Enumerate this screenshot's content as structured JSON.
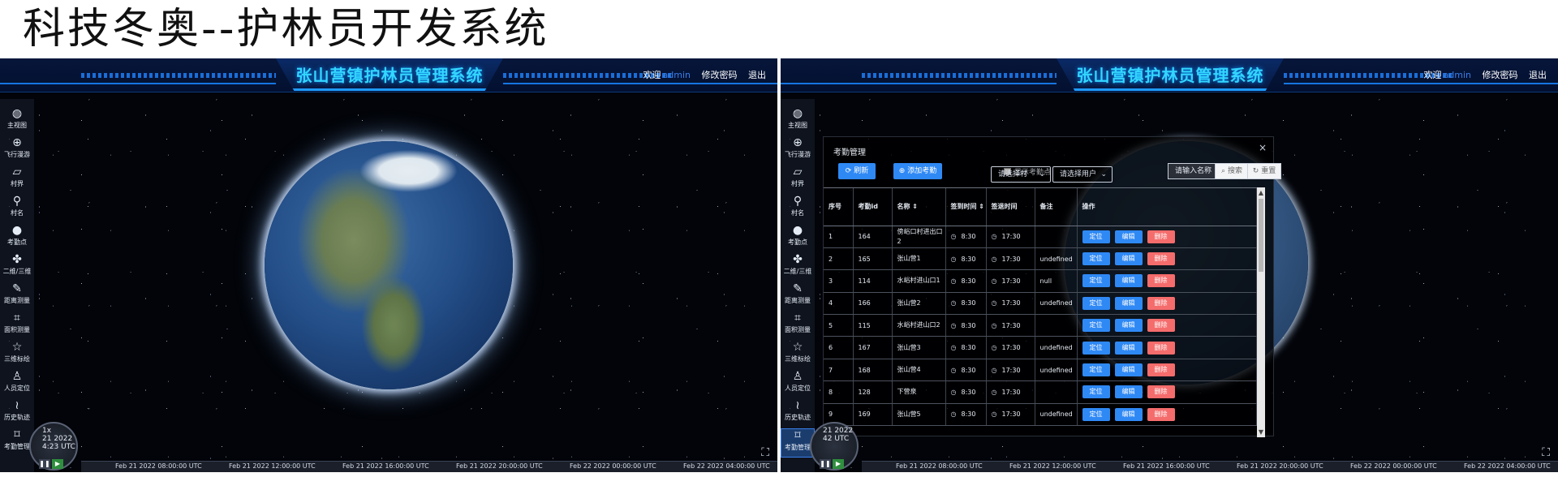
{
  "page_title": "科技冬奥--护林员开发系统",
  "header": {
    "title": "张山营镇护林员管理系统",
    "welcome": "欢迎",
    "username": "admin",
    "change_password": "修改密码",
    "logout": "退出"
  },
  "sidebar": {
    "items": [
      {
        "label": "主视图",
        "icon": "globe-icon"
      },
      {
        "label": "飞行漫游",
        "icon": "world-icon"
      },
      {
        "label": "村界",
        "icon": "boundary-icon"
      },
      {
        "label": "村名",
        "icon": "pin-icon"
      },
      {
        "label": "考勤点",
        "icon": "marker-icon"
      },
      {
        "label": "二维/三维",
        "icon": "clover-icon"
      },
      {
        "label": "距离测量",
        "icon": "ruler-icon"
      },
      {
        "label": "面积测量",
        "icon": "crop-icon"
      },
      {
        "label": "三维标绘",
        "icon": "pushpin-icon"
      },
      {
        "label": "人员定位",
        "icon": "person-icon"
      },
      {
        "label": "历史轨迹",
        "icon": "track-icon"
      },
      {
        "label": "考勤管理",
        "icon": "frame-icon"
      }
    ]
  },
  "clock": {
    "speed": "1x",
    "date": "21 2022",
    "time": "4:23 UTC",
    "date_right": "21 2022",
    "time_right": "42 UTC"
  },
  "timeline": {
    "ticks": [
      "Feb 21 2022 08:00:00 UTC",
      "Feb 21 2022 12:00:00 UTC",
      "Feb 21 2022 16:00:00 UTC",
      "Feb 21 2022 20:00:00 UTC",
      "Feb 22 2022 00:00:00 UTC",
      "Feb 22 2022 04:00:00 UTC"
    ]
  },
  "dialog": {
    "title": "考勤管理",
    "close": "×",
    "refresh": "刷新",
    "add": "添加考勤",
    "show_points": "显示考勤点",
    "select_village": "请选择村",
    "select_user": "请选择用户",
    "name_label": "请输入名称",
    "search": "搜索",
    "reset": "重置",
    "columns": [
      "序号",
      "考勤id",
      "名称 ⇕",
      "签到时间 ⇕",
      "签退时间",
      "备注",
      "操作"
    ],
    "actions": {
      "locate": "定位",
      "edit": "编辑",
      "delete": "删除"
    },
    "rows": [
      {
        "no": "1",
        "id": "164",
        "name": "傍峪口村进出口2",
        "checkin": "8:30",
        "checkout": "17:30",
        "note": ""
      },
      {
        "no": "2",
        "id": "165",
        "name": "张山营1",
        "checkin": "8:30",
        "checkout": "17:30",
        "note": "undefined"
      },
      {
        "no": "3",
        "id": "114",
        "name": "水峪村进山口1",
        "checkin": "8:30",
        "checkout": "17:30",
        "note": "null"
      },
      {
        "no": "4",
        "id": "166",
        "name": "张山营2",
        "checkin": "8:30",
        "checkout": "17:30",
        "note": "undefined"
      },
      {
        "no": "5",
        "id": "115",
        "name": "水峪村进山口2",
        "checkin": "8:30",
        "checkout": "17:30",
        "note": ""
      },
      {
        "no": "6",
        "id": "167",
        "name": "张山营3",
        "checkin": "8:30",
        "checkout": "17:30",
        "note": "undefined"
      },
      {
        "no": "7",
        "id": "168",
        "name": "张山营4",
        "checkin": "8:30",
        "checkout": "17:30",
        "note": "undefined"
      },
      {
        "no": "8",
        "id": "128",
        "name": "下营泉",
        "checkin": "8:30",
        "checkout": "17:30",
        "note": ""
      },
      {
        "no": "9",
        "id": "169",
        "name": "张山营5",
        "checkin": "8:30",
        "checkout": "17:30",
        "note": "undefined"
      }
    ]
  },
  "colors": {
    "header_title": "#33d6ff",
    "primary_button": "#2f89f5",
    "danger_button": "#f56c6c"
  }
}
